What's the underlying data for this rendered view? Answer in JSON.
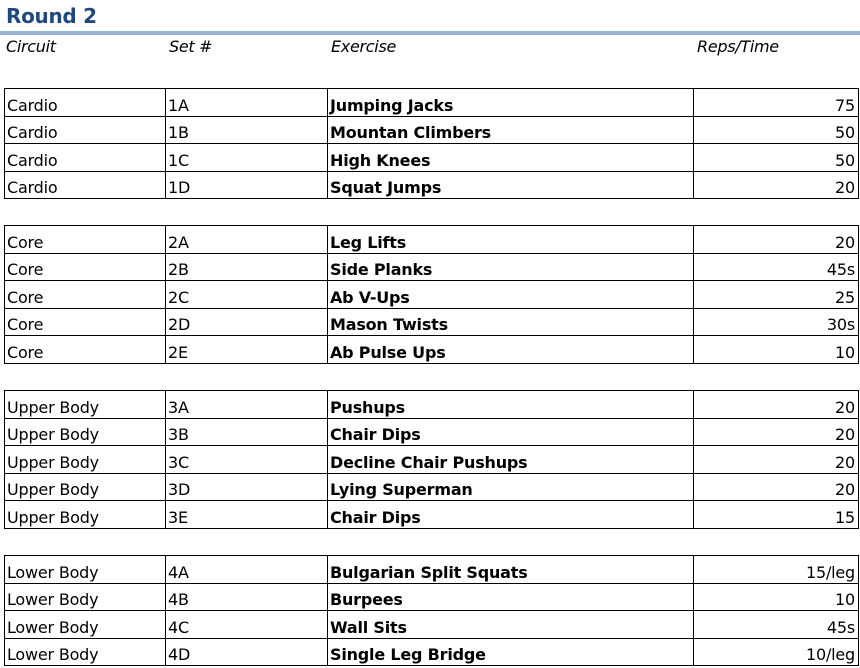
{
  "title": "Round 2",
  "colors": {
    "title": "#1f497d",
    "rule": "#95b3d7"
  },
  "headers": {
    "circuit": "Circuit",
    "set": "Set #",
    "exercise": "Exercise",
    "reps": "Reps/Time"
  },
  "sections": [
    {
      "rows": [
        {
          "circuit": "Cardio",
          "set": "1A",
          "exercise": "Jumping Jacks",
          "reps": "75"
        },
        {
          "circuit": "Cardio",
          "set": "1B",
          "exercise": "Mountan Climbers",
          "reps": "50"
        },
        {
          "circuit": "Cardio",
          "set": "1C",
          "exercise": "High Knees",
          "reps": "50"
        },
        {
          "circuit": "Cardio",
          "set": "1D",
          "exercise": "Squat Jumps",
          "reps": "20"
        }
      ]
    },
    {
      "rows": [
        {
          "circuit": "Core",
          "set": "2A",
          "exercise": "Leg Lifts",
          "reps": "20"
        },
        {
          "circuit": "Core",
          "set": "2B",
          "exercise": "Side Planks",
          "reps": "45s"
        },
        {
          "circuit": "Core",
          "set": "2C",
          "exercise": "Ab V-Ups",
          "reps": "25"
        },
        {
          "circuit": "Core",
          "set": "2D",
          "exercise": "Mason Twists",
          "reps": "30s"
        },
        {
          "circuit": "Core",
          "set": "2E",
          "exercise": "Ab Pulse Ups",
          "reps": "10"
        }
      ]
    },
    {
      "rows": [
        {
          "circuit": "Upper Body",
          "set": "3A",
          "exercise": "Pushups",
          "reps": "20"
        },
        {
          "circuit": "Upper Body",
          "set": "3B",
          "exercise": "Chair Dips",
          "reps": "20"
        },
        {
          "circuit": "Upper Body",
          "set": "3C",
          "exercise": "Decline Chair Pushups",
          "reps": "20"
        },
        {
          "circuit": "Upper Body",
          "set": "3D",
          "exercise": "Lying Superman",
          "reps": "20"
        },
        {
          "circuit": "Upper Body",
          "set": "3E",
          "exercise": "Chair Dips",
          "reps": "15"
        }
      ]
    },
    {
      "rows": [
        {
          "circuit": "Lower Body",
          "set": "4A",
          "exercise": "Bulgarian Split Squats",
          "reps": "15/leg"
        },
        {
          "circuit": "Lower Body",
          "set": "4B",
          "exercise": "Burpees",
          "reps": "10"
        },
        {
          "circuit": "Lower Body",
          "set": "4C",
          "exercise": "Wall Sits",
          "reps": "45s"
        },
        {
          "circuit": "Lower Body",
          "set": "4D",
          "exercise": "Single Leg Bridge",
          "reps": "10/leg"
        }
      ]
    }
  ]
}
